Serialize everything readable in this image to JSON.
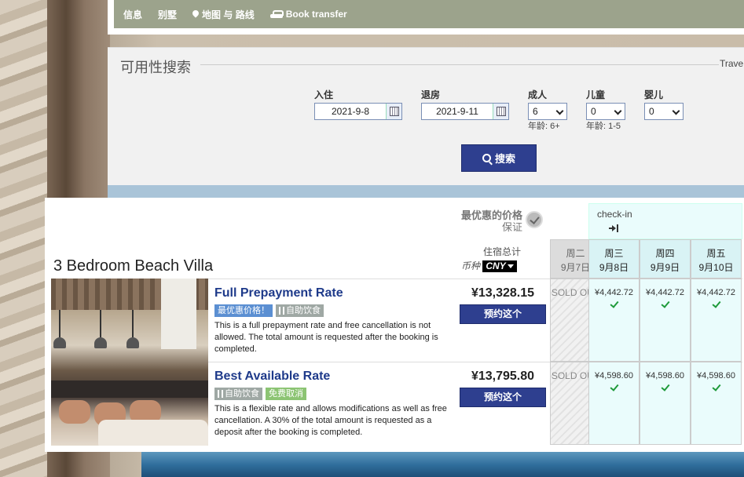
{
  "nav": {
    "items": [
      {
        "label": "信息"
      },
      {
        "label": "别墅"
      },
      {
        "label": "地图 与 路线",
        "icon": "map-pin-icon"
      },
      {
        "label": "Book transfer",
        "icon": "car-icon"
      }
    ]
  },
  "search": {
    "title": "可用性搜索",
    "traveler_label": "Trave",
    "checkin_label": "入住",
    "checkin_value": "2021-9-8",
    "checkout_label": "退房",
    "checkout_value": "2021-9-11",
    "adults_label": "成人",
    "adults_value": "6",
    "adults_hint": "年龄: 6+",
    "children_label": "儿童",
    "children_value": "0",
    "children_hint": "年龄: 1-5",
    "infants_label": "婴儿",
    "infants_value": "0",
    "search_button": "搜索"
  },
  "results": {
    "best_price_line1": "最优惠的价格",
    "best_price_line2": "保证",
    "room_title": "3 Bedroom Beach Villa",
    "total_label": "住宿总计",
    "currency_label": "币种",
    "currency_value": "CNY",
    "checkin_marker": "check-in",
    "days": [
      {
        "weekday": "周二",
        "date": "9月7日",
        "state": "past"
      },
      {
        "weekday": "周三",
        "date": "9月8日",
        "state": "active"
      },
      {
        "weekday": "周四",
        "date": "9月9日",
        "state": "active"
      },
      {
        "weekday": "周五",
        "date": "9月10日",
        "state": "active"
      }
    ],
    "rates": [
      {
        "name": "Full Prepayment Rate",
        "tags": [
          {
            "label": "最优惠价格！",
            "style": "blue"
          },
          {
            "label": "自助饮食",
            "style": "gray",
            "icon": "fork-icon"
          }
        ],
        "description": "This is a full prepayment rate and free cancellation is not allowed. The total amount is requested after the booking is completed.",
        "price": "¥13,328.15",
        "book_label": "预约这个",
        "sold_out": "SOLD OUT",
        "nightly": [
          "¥4,442.72",
          "¥4,442.72",
          "¥4,442.72"
        ]
      },
      {
        "name": "Best Available Rate",
        "tags": [
          {
            "label": "自助饮食",
            "style": "gray",
            "icon": "fork-icon"
          },
          {
            "label": "免费取消",
            "style": "green"
          }
        ],
        "description": "This is a flexible rate and allows modifications as well as free cancellation. A 30% of the total amount is requested as a deposit after the booking is completed.",
        "price": "¥13,795.80",
        "book_label": "预约这个",
        "sold_out": "SOLD OUT",
        "nightly": [
          "¥4,598.60",
          "¥4,598.60",
          "¥4,598.60"
        ]
      }
    ]
  }
}
